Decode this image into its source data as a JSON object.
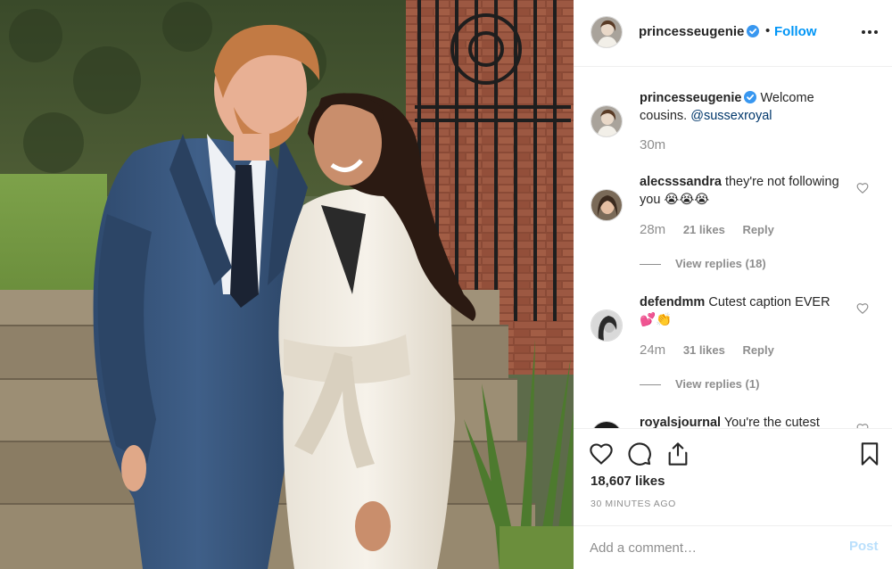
{
  "colors": {
    "accent": "#0095f6",
    "link": "#00376b",
    "muted": "#8e8e8e",
    "post_disabled": "#b9dffc"
  },
  "photo": {
    "alt": "Couple posing in front of a brick wall and iron gate"
  },
  "header": {
    "username": "princesseugenie",
    "separator": "•",
    "follow_label": "Follow",
    "more_icon": "more-options-icon"
  },
  "caption": {
    "username": "princesseugenie",
    "text": "Welcome cousins.",
    "mention": "@sussexroyal",
    "age": "30m"
  },
  "comments": [
    {
      "username": "alecsssandra",
      "text": "they're not following you 😭😭😭",
      "age": "28m",
      "likes": "21 likes",
      "reply": "Reply",
      "view_replies": "View replies (18)"
    },
    {
      "username": "defendmm",
      "text": "Cutest caption EVER 💕👏",
      "age": "24m",
      "likes": "31 likes",
      "reply": "Reply",
      "view_replies": "View replies (1)"
    },
    {
      "username": "royalsjournal",
      "text": "You're the cutest"
    }
  ],
  "actions": {
    "likes": "18,607 likes",
    "timestamp": "30 MINUTES AGO"
  },
  "add_comment": {
    "placeholder": "Add a comment…",
    "post_label": "Post"
  }
}
